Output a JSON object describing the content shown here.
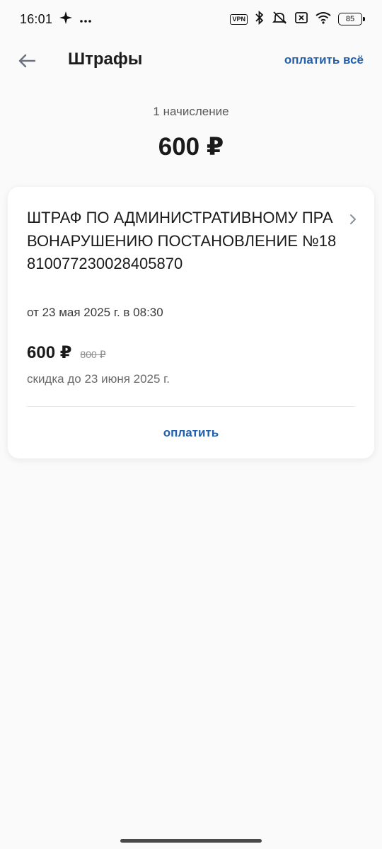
{
  "status_bar": {
    "time": "16:01",
    "vpn": "VPN",
    "battery": "85",
    "icons": [
      "sparkle-icon",
      "more-dots-icon",
      "bluetooth-icon",
      "mute-icon",
      "no-sim-icon",
      "wifi-icon",
      "battery-icon"
    ]
  },
  "header": {
    "title": "Штрафы",
    "pay_all_label": "оплатить всё",
    "back_icon": "arrow-left-icon"
  },
  "summary": {
    "count_label": "1 начисление",
    "total": "600 ₽"
  },
  "fine": {
    "title": "ШТРАФ ПО АДМИНИСТРАТИВНОМУ ПРАВОНАРУШЕНИЮ ПОСТАНОВЛЕНИЕ №18810077230028405870",
    "date": "от 23 мая 2025 г. в 08:30",
    "amount": "600 ₽",
    "old_amount": "800 ₽",
    "discount_note": "скидка до 23 июня 2025 г.",
    "pay_label": "оплатить"
  },
  "colors": {
    "accent": "#1f5fae",
    "background": "#fafafa",
    "card": "#ffffff"
  }
}
